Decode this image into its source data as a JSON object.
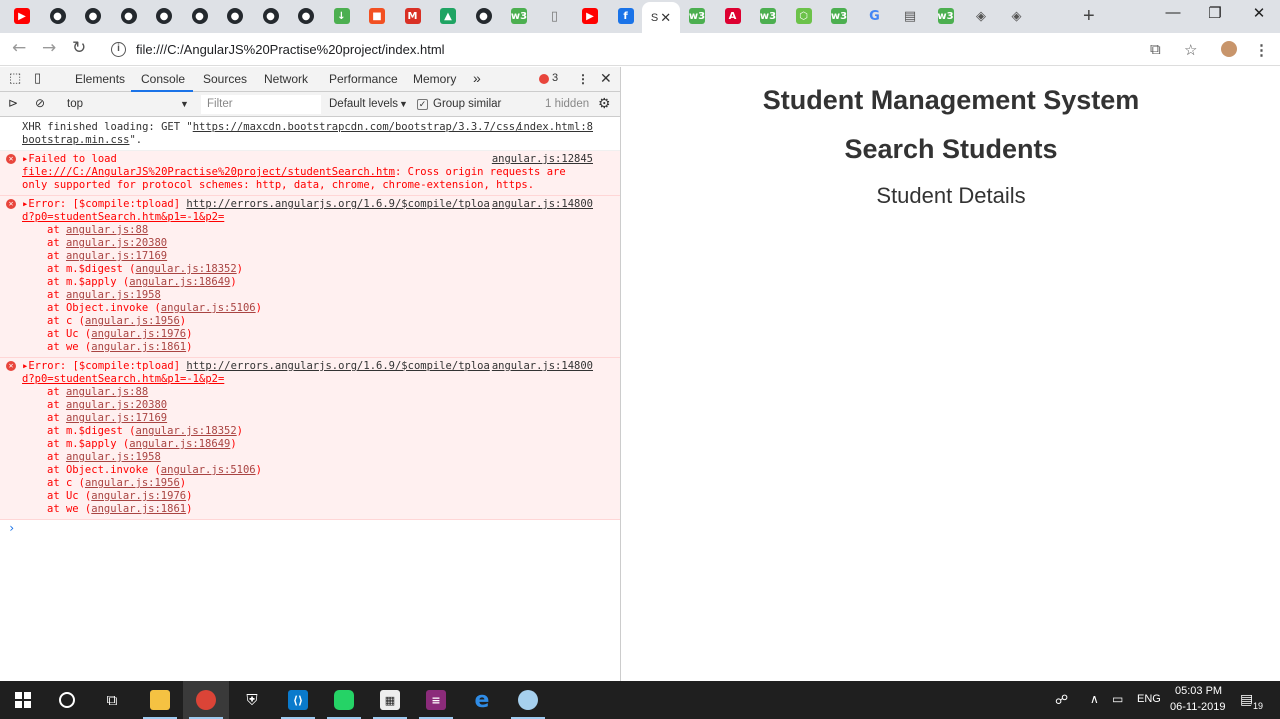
{
  "browser": {
    "url": "file:///C:/AngularJS%20Practise%20project/index.html",
    "active_tab_label": "S",
    "tabs": [
      {
        "icon": "youtube-icon",
        "color": "#ff0000"
      },
      {
        "icon": "github-icon",
        "color": "#24292e"
      },
      {
        "icon": "github-icon",
        "color": "#24292e"
      },
      {
        "icon": "github-icon",
        "color": "#24292e"
      },
      {
        "icon": "github-icon",
        "color": "#24292e"
      },
      {
        "icon": "github-icon",
        "color": "#24292e"
      },
      {
        "icon": "github-icon",
        "color": "#24292e"
      },
      {
        "icon": "github-icon",
        "color": "#24292e"
      },
      {
        "icon": "github-icon",
        "color": "#24292e"
      },
      {
        "icon": "download-icon",
        "color": "#4caf50"
      },
      {
        "icon": "microsoft-icon",
        "color": "#f25022"
      },
      {
        "icon": "gmail-icon",
        "color": "#d93025"
      },
      {
        "icon": "drive-icon",
        "color": "#1fa463"
      },
      {
        "icon": "github-icon",
        "color": "#24292e"
      },
      {
        "icon": "w3schools-icon",
        "color": "#4caf50"
      },
      {
        "icon": "document-icon",
        "color": "#777777"
      },
      {
        "icon": "youtube-icon",
        "color": "#ff0000"
      },
      {
        "icon": "facebook-icon",
        "color": "#1a73e8"
      },
      {
        "icon": "w3schools-icon",
        "color": "#4caf50"
      },
      {
        "icon": "angular-icon",
        "color": "#dd0031"
      },
      {
        "icon": "w3schools-icon",
        "color": "#4caf50"
      },
      {
        "icon": "node-icon",
        "color": "#6cc24a"
      },
      {
        "icon": "w3schools-icon",
        "color": "#4caf50"
      },
      {
        "icon": "google-icon",
        "color": "#4285f4"
      },
      {
        "icon": "news-icon",
        "color": "#555555"
      },
      {
        "icon": "w3schools-icon",
        "color": "#4caf50"
      },
      {
        "icon": "diamond-icon",
        "color": "#555555"
      },
      {
        "icon": "diamond-icon",
        "color": "#555555"
      }
    ]
  },
  "devtools": {
    "tabs": [
      "Elements",
      "Console",
      "Sources",
      "Network",
      "Performance",
      "Memory"
    ],
    "error_count": "3",
    "context": "top",
    "filter_placeholder": "Filter",
    "levels": "Default levels",
    "group_similar": "Group similar",
    "hidden": "1 hidden",
    "messages": {
      "xhr": {
        "text_prefix": "XHR finished loading: GET \"",
        "link": "https://maxcdn.bootstrapcdn.com/bootstrap/3.3.7/css/",
        "link2": "bootstrap.min.css",
        "text_suffix": "\".",
        "source": "index.html:8"
      },
      "fail": {
        "text": "Failed to load",
        "link": "file:///C:/AngularJS%20Practise%20project/studentSearch.htm",
        "rest": ": Cross origin requests are only supported for protocol schemes: http, data, chrome, chrome-extension, https.",
        "source": "angular.js:12845"
      },
      "errors": [
        {
          "prefix": "Error: [$compile:tpload] ",
          "link": "http://errors.angularjs.org/1.6.9/$compile/tploa",
          "link2": "d?p0=studentSearch.htm&p1=-1&p2=",
          "source": "angular.js:14800",
          "stack": [
            {
              "pre": "at ",
              "link": "angular.js:88",
              "post": ""
            },
            {
              "pre": "at ",
              "link": "angular.js:20380",
              "post": ""
            },
            {
              "pre": "at ",
              "link": "angular.js:17169",
              "post": ""
            },
            {
              "pre": "at m.$digest (",
              "link": "angular.js:18352",
              "post": ")"
            },
            {
              "pre": "at m.$apply (",
              "link": "angular.js:18649",
              "post": ")"
            },
            {
              "pre": "at ",
              "link": "angular.js:1958",
              "post": ""
            },
            {
              "pre": "at Object.invoke (",
              "link": "angular.js:5106",
              "post": ")"
            },
            {
              "pre": "at c (",
              "link": "angular.js:1956",
              "post": ")"
            },
            {
              "pre": "at Uc (",
              "link": "angular.js:1976",
              "post": ")"
            },
            {
              "pre": "at we (",
              "link": "angular.js:1861",
              "post": ")"
            }
          ]
        },
        {
          "prefix": "Error: [$compile:tpload] ",
          "link": "http://errors.angularjs.org/1.6.9/$compile/tploa",
          "link2": "d?p0=studentSearch.htm&p1=-1&p2=",
          "source": "angular.js:14800",
          "stack": [
            {
              "pre": "at ",
              "link": "angular.js:88",
              "post": ""
            },
            {
              "pre": "at ",
              "link": "angular.js:20380",
              "post": ""
            },
            {
              "pre": "at ",
              "link": "angular.js:17169",
              "post": ""
            },
            {
              "pre": "at m.$digest (",
              "link": "angular.js:18352",
              "post": ")"
            },
            {
              "pre": "at m.$apply (",
              "link": "angular.js:18649",
              "post": ")"
            },
            {
              "pre": "at ",
              "link": "angular.js:1958",
              "post": ""
            },
            {
              "pre": "at Object.invoke (",
              "link": "angular.js:5106",
              "post": ")"
            },
            {
              "pre": "at c (",
              "link": "angular.js:1956",
              "post": ")"
            },
            {
              "pre": "at Uc (",
              "link": "angular.js:1976",
              "post": ")"
            },
            {
              "pre": "at we (",
              "link": "angular.js:1861",
              "post": ")"
            }
          ]
        }
      ]
    }
  },
  "page": {
    "title": "Student Management System",
    "subtitle": "Search Students",
    "section": "Student Details"
  },
  "taskbar": {
    "language": "ENG",
    "time": "05:03 PM",
    "date": "06-11-2019",
    "notifications": "19"
  }
}
